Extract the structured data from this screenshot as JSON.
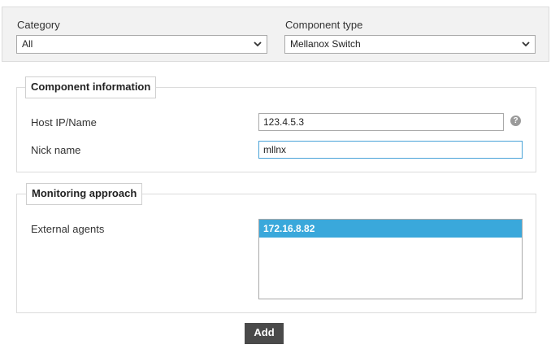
{
  "filters": {
    "category_label": "Category",
    "category_value": "All",
    "component_type_label": "Component type",
    "component_type_value": "Mellanox Switch"
  },
  "component_info": {
    "legend": "Component information",
    "host_label": "Host IP/Name",
    "host_value": "123.4.5.3",
    "help_glyph": "?",
    "nick_label": "Nick name",
    "nick_value": "mllnx"
  },
  "monitoring": {
    "legend": "Monitoring approach",
    "agents_label": "External agents",
    "agents_options": [
      "172.16.8.82"
    ]
  },
  "actions": {
    "add_label": "Add"
  },
  "colors": {
    "selected_option": "#3aa8db",
    "button_bg": "#4a4a4a",
    "focus_border": "#4aa3d8"
  }
}
